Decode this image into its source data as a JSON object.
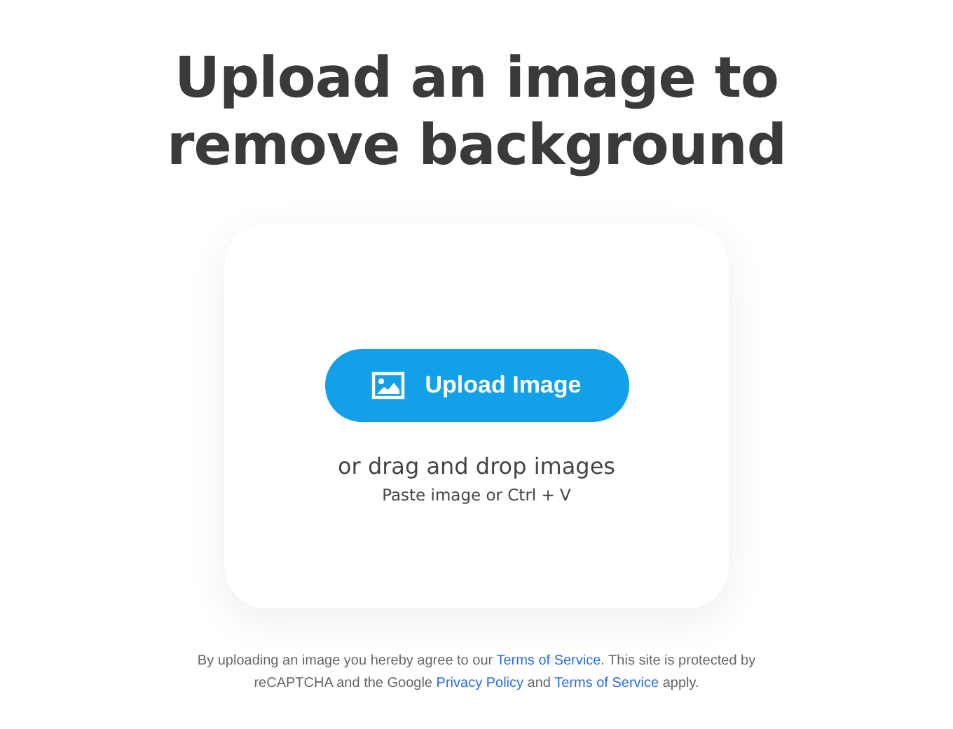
{
  "heading": "Upload an image to remove background",
  "upload_button": {
    "label": "Upload Image"
  },
  "drop_hint": "or drag and drop images",
  "paste_hint": "Paste image or Ctrl + V",
  "notice": [
    {
      "kind": "text",
      "text": "By uploading an image you hereby agree to our "
    },
    {
      "kind": "link",
      "text": "Terms of Service"
    },
    {
      "kind": "text",
      "text": ". This site is protected by reCAPTCHA and the Google "
    },
    {
      "kind": "link",
      "text": "Privacy Policy"
    },
    {
      "kind": "text",
      "text": " and "
    },
    {
      "kind": "link",
      "text": "Terms of Service"
    },
    {
      "kind": "text",
      "text": " apply."
    }
  ]
}
